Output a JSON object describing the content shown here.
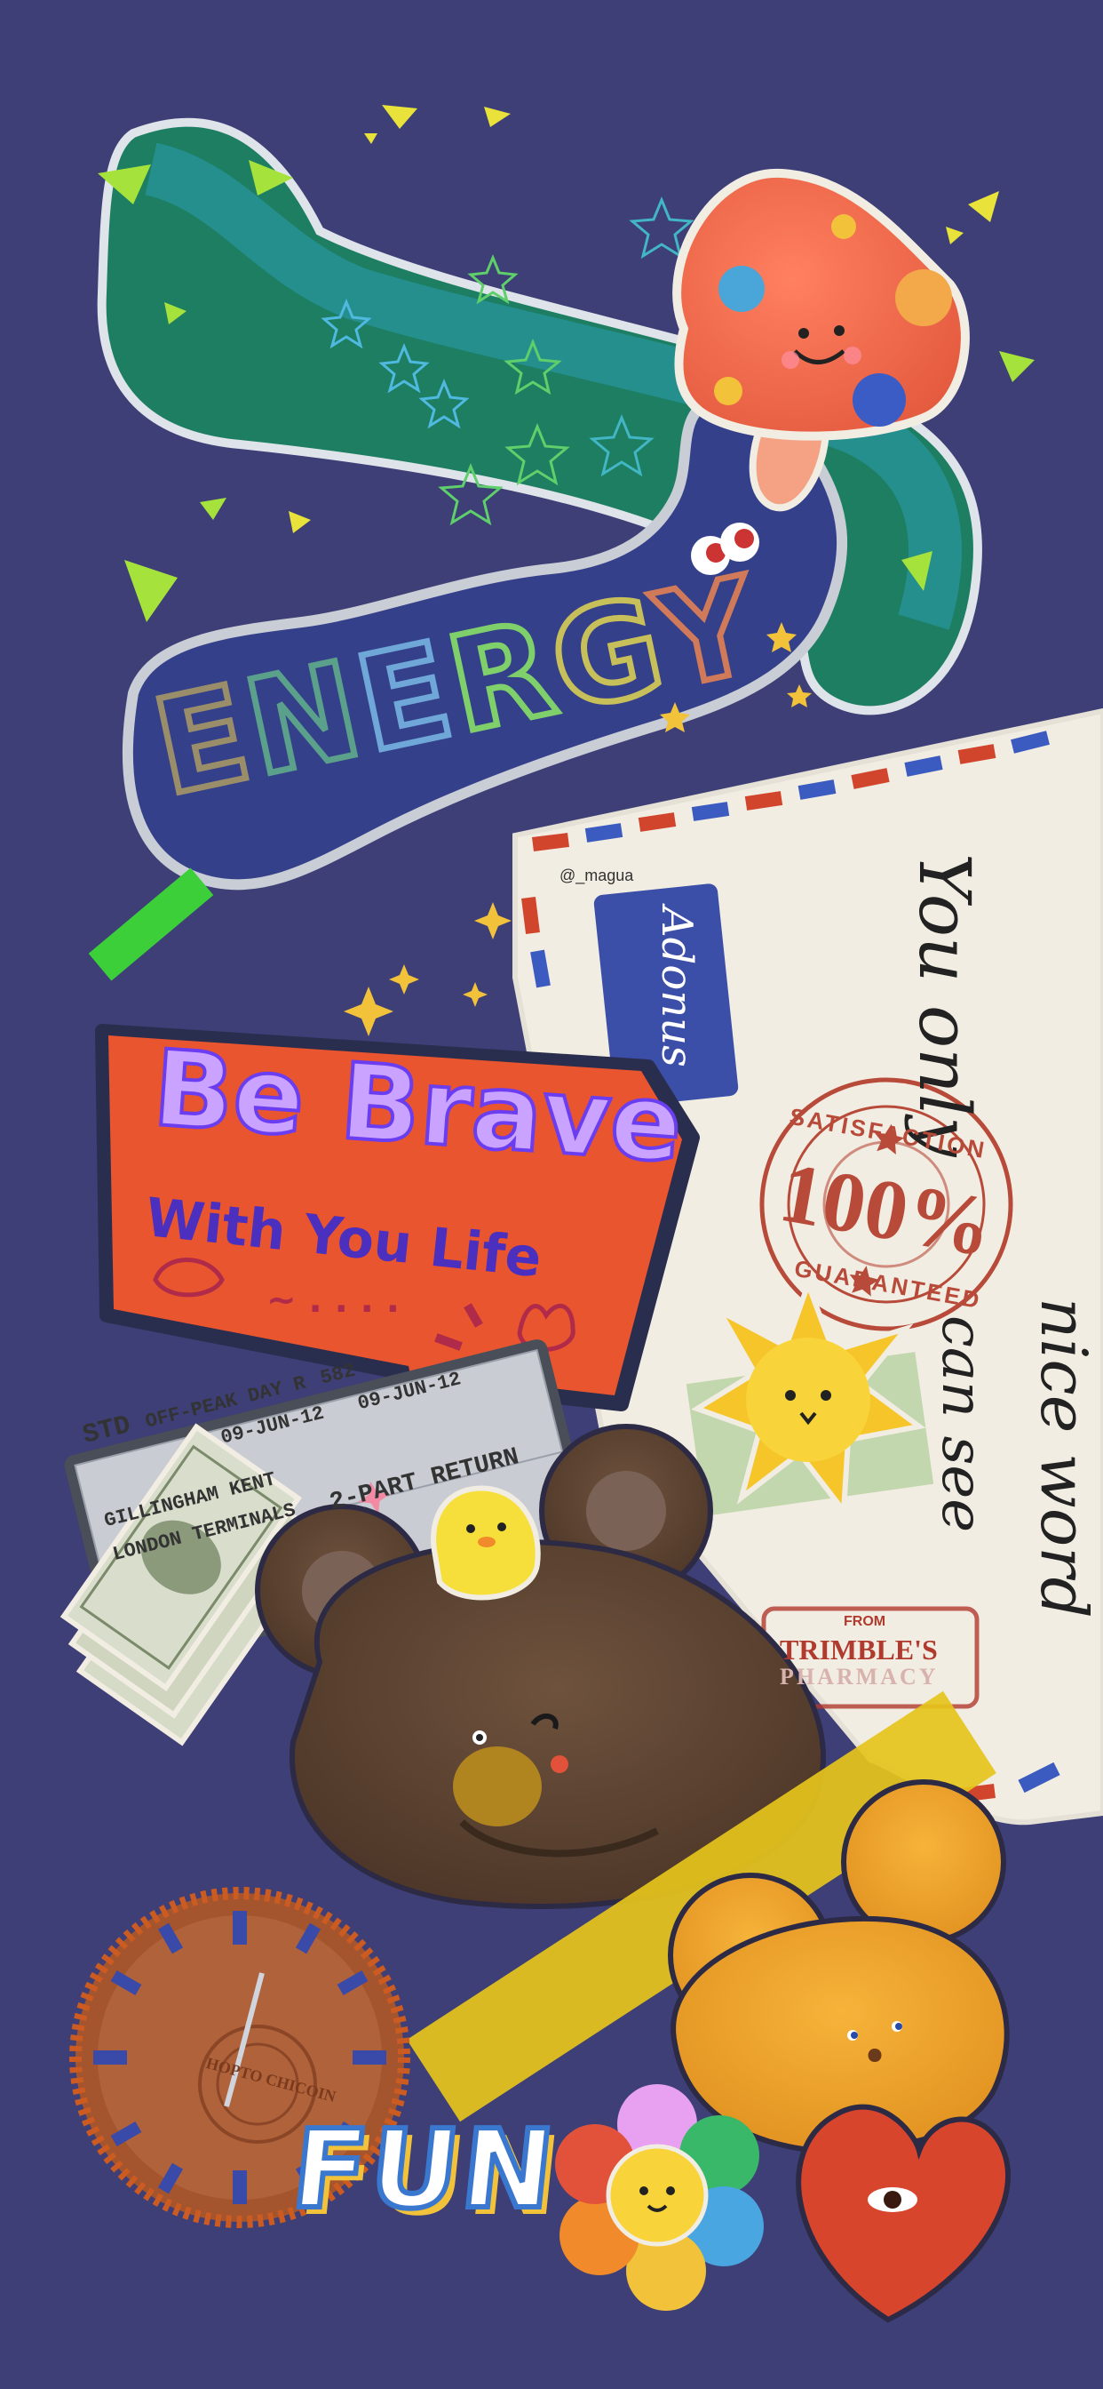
{
  "stickers": {
    "energy": {
      "letters": [
        "E",
        "N",
        "E",
        "R",
        "G",
        "Y"
      ]
    },
    "brave": {
      "title": "Be Brave",
      "subtitle": "With You Life",
      "dots": "~ . . . ."
    },
    "envelope": {
      "handle": "@_magua",
      "handwriting_1": "You only",
      "handwriting_2": "nice word",
      "handwriting_3": "can see",
      "label": "Adonus"
    },
    "stamp": {
      "top": "SATISFACTION",
      "value": "100%",
      "bottom": "GUARANTEED"
    },
    "ticket": {
      "class": "STD",
      "type": "OFF-PEAK DAY R",
      "number": "582",
      "date_1": "09-JUN-12",
      "date_2": "09-JUN-12",
      "from": "GILLINGHAM KENT",
      "to": "LONDON TERMINALS",
      "code": "2-PART RETURN"
    },
    "pharmacy": {
      "from": "FROM",
      "name": "TRIMBLE'S",
      "sub": "PHARMACY"
    },
    "fun": "FUN",
    "clock_label": "HOPTO CHICOIN"
  },
  "colors": {
    "background": "#3d3f76",
    "banana": "#1f8a63",
    "mushroom_cap": "#f06a4a",
    "energy_cloud": "#35408a",
    "brave_panel": "#e8552f",
    "envelope": "#f2ede2",
    "bear_brown": "#5c4331",
    "bear_orange": "#f0a52a",
    "tape_yellow": "#e6c41c",
    "heart": "#d8452d"
  }
}
